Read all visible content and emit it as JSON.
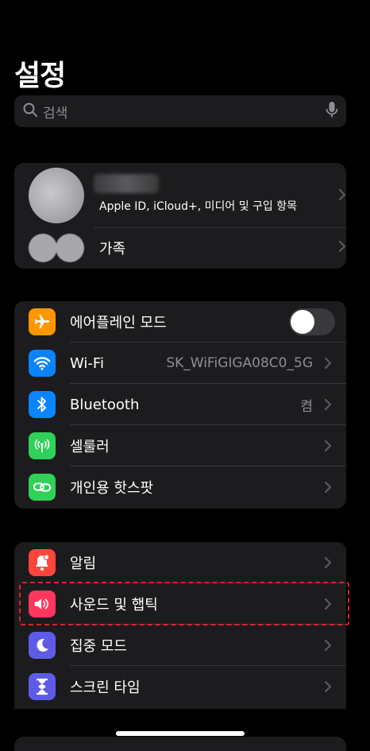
{
  "header": {
    "title": "설정"
  },
  "search": {
    "placeholder": "검색"
  },
  "profile": {
    "subtitle": "Apple ID, iCloud+, 미디어 및 구입 항목",
    "family_label": "가족"
  },
  "connectivity": [
    {
      "id": "airplane",
      "label": "에어플레인 모드",
      "icon": "airplane-icon",
      "color": "#ff9500",
      "toggle": false
    },
    {
      "id": "wifi",
      "label": "Wi-Fi",
      "value": "SK_WiFiGIGA08C0_5G",
      "icon": "wifi-icon",
      "color": "#0a84ff"
    },
    {
      "id": "bluetooth",
      "label": "Bluetooth",
      "value": "켬",
      "icon": "bluetooth-icon",
      "color": "#0a84ff"
    },
    {
      "id": "cellular",
      "label": "셀룰러",
      "icon": "antenna-icon",
      "color": "#30d158"
    },
    {
      "id": "hotspot",
      "label": "개인용 핫스팟",
      "icon": "link-icon",
      "color": "#30d158"
    }
  ],
  "notifications": [
    {
      "id": "alerts",
      "label": "알림",
      "icon": "bell-icon",
      "color": "#ff453a"
    },
    {
      "id": "sound",
      "label": "사운드 및 햅틱",
      "icon": "speaker-icon",
      "color": "#ff375f",
      "highlighted": true
    },
    {
      "id": "focus",
      "label": "집중 모드",
      "icon": "moon-icon",
      "color": "#5e5ce6"
    },
    {
      "id": "screentime",
      "label": "스크린 타임",
      "icon": "hourglass-icon",
      "color": "#5e5ce6"
    }
  ]
}
